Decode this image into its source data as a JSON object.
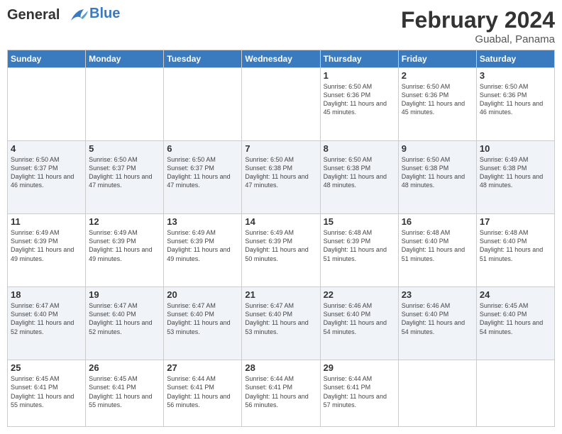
{
  "header": {
    "logo_line1": "General",
    "logo_line2": "Blue",
    "month": "February 2024",
    "location": "Guabal, Panama"
  },
  "days_of_week": [
    "Sunday",
    "Monday",
    "Tuesday",
    "Wednesday",
    "Thursday",
    "Friday",
    "Saturday"
  ],
  "weeks": [
    [
      {
        "num": "",
        "empty": true,
        "info": ""
      },
      {
        "num": "",
        "empty": true,
        "info": ""
      },
      {
        "num": "",
        "empty": true,
        "info": ""
      },
      {
        "num": "",
        "empty": true,
        "info": ""
      },
      {
        "num": "1",
        "info": "Sunrise: 6:50 AM\nSunset: 6:36 PM\nDaylight: 11 hours\nand 45 minutes."
      },
      {
        "num": "2",
        "info": "Sunrise: 6:50 AM\nSunset: 6:36 PM\nDaylight: 11 hours\nand 45 minutes."
      },
      {
        "num": "3",
        "info": "Sunrise: 6:50 AM\nSunset: 6:36 PM\nDaylight: 11 hours\nand 46 minutes."
      }
    ],
    [
      {
        "num": "4",
        "info": "Sunrise: 6:50 AM\nSunset: 6:37 PM\nDaylight: 11 hours\nand 46 minutes."
      },
      {
        "num": "5",
        "info": "Sunrise: 6:50 AM\nSunset: 6:37 PM\nDaylight: 11 hours\nand 47 minutes."
      },
      {
        "num": "6",
        "info": "Sunrise: 6:50 AM\nSunset: 6:37 PM\nDaylight: 11 hours\nand 47 minutes."
      },
      {
        "num": "7",
        "info": "Sunrise: 6:50 AM\nSunset: 6:38 PM\nDaylight: 11 hours\nand 47 minutes."
      },
      {
        "num": "8",
        "info": "Sunrise: 6:50 AM\nSunset: 6:38 PM\nDaylight: 11 hours\nand 48 minutes."
      },
      {
        "num": "9",
        "info": "Sunrise: 6:50 AM\nSunset: 6:38 PM\nDaylight: 11 hours\nand 48 minutes."
      },
      {
        "num": "10",
        "info": "Sunrise: 6:49 AM\nSunset: 6:38 PM\nDaylight: 11 hours\nand 48 minutes."
      }
    ],
    [
      {
        "num": "11",
        "info": "Sunrise: 6:49 AM\nSunset: 6:39 PM\nDaylight: 11 hours\nand 49 minutes."
      },
      {
        "num": "12",
        "info": "Sunrise: 6:49 AM\nSunset: 6:39 PM\nDaylight: 11 hours\nand 49 minutes."
      },
      {
        "num": "13",
        "info": "Sunrise: 6:49 AM\nSunset: 6:39 PM\nDaylight: 11 hours\nand 49 minutes."
      },
      {
        "num": "14",
        "info": "Sunrise: 6:49 AM\nSunset: 6:39 PM\nDaylight: 11 hours\nand 50 minutes."
      },
      {
        "num": "15",
        "info": "Sunrise: 6:48 AM\nSunset: 6:39 PM\nDaylight: 11 hours\nand 51 minutes."
      },
      {
        "num": "16",
        "info": "Sunrise: 6:48 AM\nSunset: 6:40 PM\nDaylight: 11 hours\nand 51 minutes."
      },
      {
        "num": "17",
        "info": "Sunrise: 6:48 AM\nSunset: 6:40 PM\nDaylight: 11 hours\nand 51 minutes."
      }
    ],
    [
      {
        "num": "18",
        "info": "Sunrise: 6:47 AM\nSunset: 6:40 PM\nDaylight: 11 hours\nand 52 minutes."
      },
      {
        "num": "19",
        "info": "Sunrise: 6:47 AM\nSunset: 6:40 PM\nDaylight: 11 hours\nand 52 minutes."
      },
      {
        "num": "20",
        "info": "Sunrise: 6:47 AM\nSunset: 6:40 PM\nDaylight: 11 hours\nand 53 minutes."
      },
      {
        "num": "21",
        "info": "Sunrise: 6:47 AM\nSunset: 6:40 PM\nDaylight: 11 hours\nand 53 minutes."
      },
      {
        "num": "22",
        "info": "Sunrise: 6:46 AM\nSunset: 6:40 PM\nDaylight: 11 hours\nand 54 minutes."
      },
      {
        "num": "23",
        "info": "Sunrise: 6:46 AM\nSunset: 6:40 PM\nDaylight: 11 hours\nand 54 minutes."
      },
      {
        "num": "24",
        "info": "Sunrise: 6:45 AM\nSunset: 6:40 PM\nDaylight: 11 hours\nand 54 minutes."
      }
    ],
    [
      {
        "num": "25",
        "info": "Sunrise: 6:45 AM\nSunset: 6:41 PM\nDaylight: 11 hours\nand 55 minutes."
      },
      {
        "num": "26",
        "info": "Sunrise: 6:45 AM\nSunset: 6:41 PM\nDaylight: 11 hours\nand 55 minutes."
      },
      {
        "num": "27",
        "info": "Sunrise: 6:44 AM\nSunset: 6:41 PM\nDaylight: 11 hours\nand 56 minutes."
      },
      {
        "num": "28",
        "info": "Sunrise: 6:44 AM\nSunset: 6:41 PM\nDaylight: 11 hours\nand 56 minutes."
      },
      {
        "num": "29",
        "info": "Sunrise: 6:44 AM\nSunset: 6:41 PM\nDaylight: 11 hours\nand 57 minutes."
      },
      {
        "num": "",
        "empty": true,
        "info": ""
      },
      {
        "num": "",
        "empty": true,
        "info": ""
      }
    ]
  ]
}
